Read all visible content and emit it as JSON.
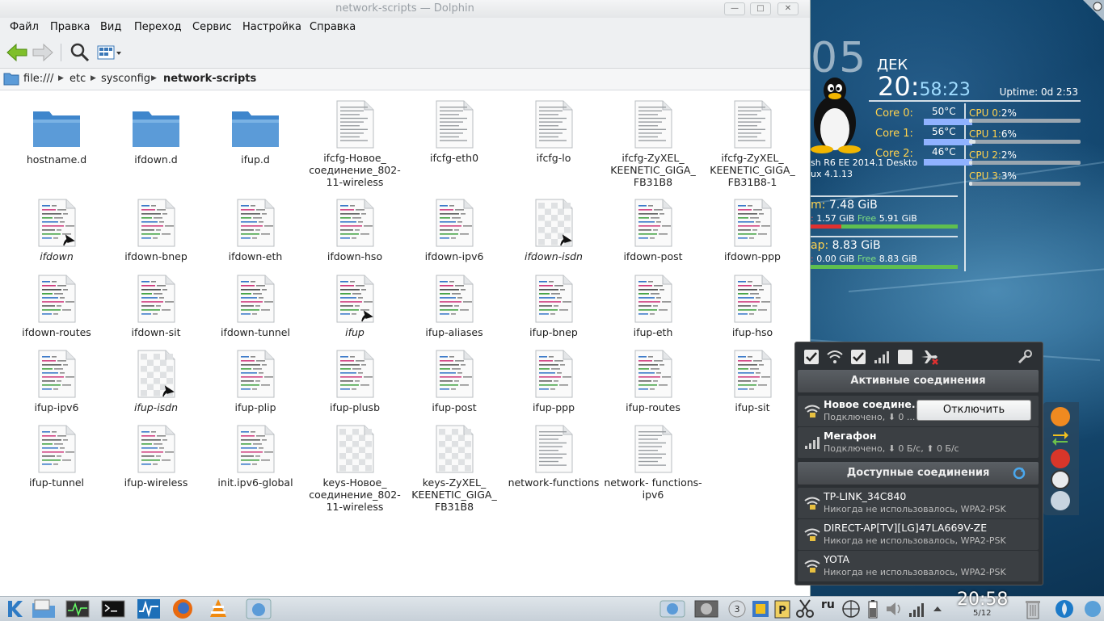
{
  "window": {
    "title": "network-scripts — Dolphin",
    "menu": [
      "Файл",
      "Правка",
      "Вид",
      "Переход",
      "Сервис",
      "Настройка",
      "Справка"
    ]
  },
  "location": {
    "root": "file:///",
    "crumbs": [
      "etc",
      "sysconfig",
      "network-scripts"
    ]
  },
  "files": [
    {
      "name": "hostname.d",
      "kind": "folder",
      "link": false
    },
    {
      "name": "ifdown.d",
      "kind": "folder",
      "link": false
    },
    {
      "name": "ifup.d",
      "kind": "folder",
      "link": false
    },
    {
      "name": "ifcfg-Новое_ соединение_802- 11-wireless",
      "kind": "text",
      "link": false
    },
    {
      "name": "ifcfg-eth0",
      "kind": "text",
      "link": false
    },
    {
      "name": "ifcfg-lo",
      "kind": "text",
      "link": false
    },
    {
      "name": "ifcfg-ZyXEL_ KEENETIC_GIGA_ FB31B8",
      "kind": "text",
      "link": false
    },
    {
      "name": "ifcfg-ZyXEL_ KEENETIC_GIGA_ FB31B8-1",
      "kind": "text",
      "link": false
    },
    {
      "name": "ifdown",
      "kind": "script",
      "link": true
    },
    {
      "name": "ifdown-bnep",
      "kind": "script",
      "link": false
    },
    {
      "name": "ifdown-eth",
      "kind": "script",
      "link": false
    },
    {
      "name": "ifdown-hso",
      "kind": "script",
      "link": false
    },
    {
      "name": "ifdown-ipv6",
      "kind": "script",
      "link": false
    },
    {
      "name": "ifdown-isdn",
      "kind": "blank",
      "link": true
    },
    {
      "name": "ifdown-post",
      "kind": "script",
      "link": false
    },
    {
      "name": "ifdown-ppp",
      "kind": "script",
      "link": false
    },
    {
      "name": "ifdown-routes",
      "kind": "script",
      "link": false
    },
    {
      "name": "ifdown-sit",
      "kind": "script",
      "link": false
    },
    {
      "name": "ifdown-tunnel",
      "kind": "script",
      "link": false
    },
    {
      "name": "ifup",
      "kind": "script",
      "link": true
    },
    {
      "name": "ifup-aliases",
      "kind": "script",
      "link": false
    },
    {
      "name": "ifup-bnep",
      "kind": "script",
      "link": false
    },
    {
      "name": "ifup-eth",
      "kind": "script",
      "link": false
    },
    {
      "name": "ifup-hso",
      "kind": "script",
      "link": false
    },
    {
      "name": "ifup-ipv6",
      "kind": "script",
      "link": false
    },
    {
      "name": "ifup-isdn",
      "kind": "blank",
      "link": true
    },
    {
      "name": "ifup-plip",
      "kind": "script",
      "link": false
    },
    {
      "name": "ifup-plusb",
      "kind": "script",
      "link": false
    },
    {
      "name": "ifup-post",
      "kind": "script",
      "link": false
    },
    {
      "name": "ifup-ppp",
      "kind": "script",
      "link": false
    },
    {
      "name": "ifup-routes",
      "kind": "script",
      "link": false
    },
    {
      "name": "ifup-sit",
      "kind": "script",
      "link": false
    },
    {
      "name": "ifup-tunnel",
      "kind": "script",
      "link": false
    },
    {
      "name": "ifup-wireless",
      "kind": "script",
      "link": false
    },
    {
      "name": "init.ipv6-global",
      "kind": "script",
      "link": false
    },
    {
      "name": "keys-Новое_ соединение_802- 11-wireless",
      "kind": "blank",
      "link": false
    },
    {
      "name": "keys-ZyXEL_ KEENETIC_GIGA_ FB31B8",
      "kind": "blank",
      "link": false
    },
    {
      "name": "network-functions",
      "kind": "text",
      "link": false
    },
    {
      "name": "network- functions-ipv6",
      "kind": "text",
      "link": false
    }
  ],
  "conky": {
    "day": "05",
    "month": "ДЕК",
    "time_hm": "20:",
    "time_m": "58",
    "time_s": ":23",
    "uptime": "Uptime: 0d 2:53",
    "cores": [
      {
        "label": "Core 0:",
        "temp": "50°C"
      },
      {
        "label": "Core 1:",
        "temp": "56°C"
      },
      {
        "label": "Core 2:",
        "temp": "46°C"
      }
    ],
    "cpus": [
      {
        "label": "CPU 0:",
        "value": "2%",
        "level": 0.02
      },
      {
        "label": "CPU 1:",
        "value": "6%",
        "level": 0.06
      },
      {
        "label": "CPU 2:",
        "value": "2%",
        "level": 0.02
      },
      {
        "label": "CPU 3:",
        "value": "3%",
        "level": 0.03
      }
    ],
    "sys_line1": "sh R6 EE 2014.1 Deskto",
    "sys_line2": "ux 4.1.13",
    "ram_label": "m:",
    "ram_total": "7.48 GiB",
    "ram_used_prefix": ":",
    "ram_used": "1.57 GiB",
    "ram_free_word": "Free",
    "ram_free": "5.91 GiB",
    "ram_used_fraction": 0.21,
    "swap_label": "ap:",
    "swap_total": "8.83 GiB",
    "swap_used_prefix": ":",
    "swap_used": "0.00 GiB",
    "swap_free_word": "Free",
    "swap_free": "8.83 GiB",
    "swap_used_fraction": 0.0
  },
  "network": {
    "active_header": "Активные соединения",
    "available_header": "Доступные соединения",
    "active": [
      {
        "name": "Новое соедине...",
        "status": "Подключено, ⬇ 0 ...",
        "button": "Отключить"
      },
      {
        "name": "Мегафон",
        "status": "Подключено, ⬇ 0 Б/с, ⬆ 0 Б/с"
      }
    ],
    "available": [
      {
        "name": "TP-LINK_34C840",
        "status": "Никогда не использовалось, WPA2-PSK"
      },
      {
        "name": "DIRECT-AP[TV][LG]47LA669V-ZE",
        "status": "Никогда не использовалось, WPA2-PSK"
      },
      {
        "name": "YOTA",
        "status": "Никогда не использовалось, WPA2-PSK"
      }
    ]
  },
  "taskbar": {
    "keyboard_layout": "ru",
    "clock": "20:58",
    "date": "5/12"
  },
  "colors": {
    "folder": "#5b9bd8",
    "accent": "#2f7bc4",
    "popup_bg": "#2c3034"
  }
}
